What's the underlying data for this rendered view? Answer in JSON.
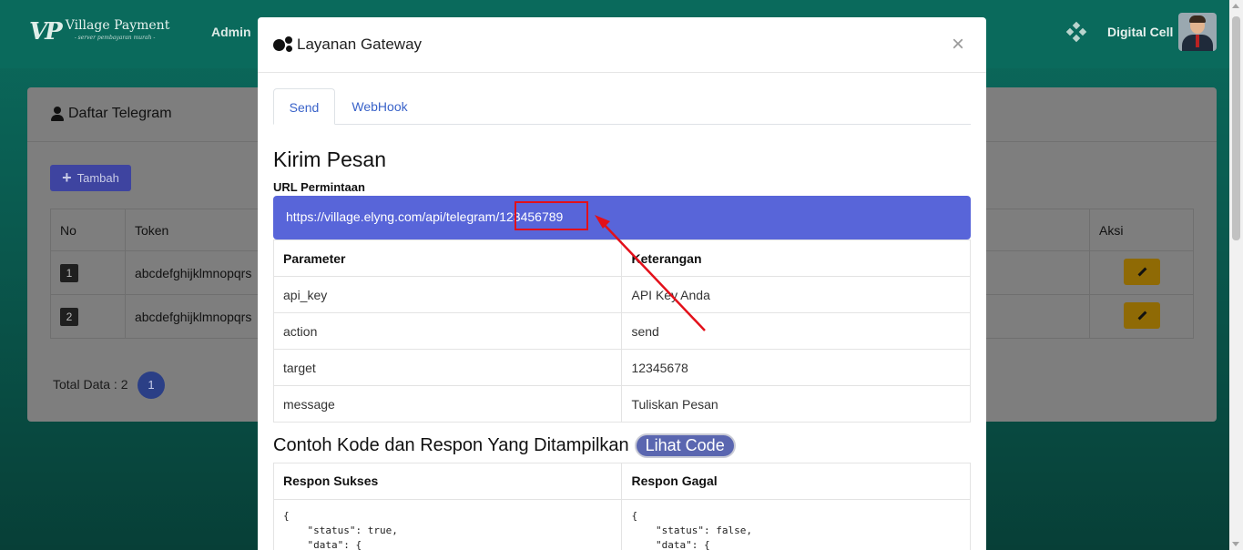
{
  "app": {
    "logo_mark": "VP",
    "logo_name": "Village Payment",
    "logo_tagline": "- server pembayaran murah -",
    "nav_admin": "Admin",
    "user_name": "Digital Cell"
  },
  "card": {
    "title": "Daftar Telegram",
    "add_button": "Tambah",
    "columns": [
      "No",
      "Token",
      "Aksi"
    ],
    "rows": [
      {
        "no": "1",
        "token": "abcdefghijklmnopqrs"
      },
      {
        "no": "2",
        "token": "abcdefghijklmnopqrs"
      }
    ],
    "total_label": "Total Data : 2",
    "current_page": "1"
  },
  "modal": {
    "title": "Layanan Gateway",
    "close": "×",
    "tabs": [
      "Send",
      "WebHook"
    ],
    "active_tab": "Send",
    "heading": "Kirim Pesan",
    "url_label": "URL Permintaan",
    "url": "https://village.elyng.com/api/telegram/123456789",
    "params_header": {
      "param": "Parameter",
      "desc": "Keterangan"
    },
    "params": [
      {
        "param": "api_key",
        "desc": "API Key Anda"
      },
      {
        "param": "action",
        "desc": "send"
      },
      {
        "param": "target",
        "desc": "12345678"
      },
      {
        "param": "message",
        "desc": "Tuliskan Pesan"
      }
    ],
    "example_heading": "Contoh Kode dan Respon Yang Ditampilkan",
    "view_code_button": "Lihat Code",
    "response_success_label": "Respon Sukses",
    "response_fail_label": "Respon Gagal",
    "response_success_code": "{\n    \"status\": true,\n    \"data\": {",
    "response_fail_code": "{\n    \"status\": false,\n    \"data\": {"
  },
  "colors": {
    "accent": "#5865d9",
    "annotation": "#e3101a",
    "tab_link": "#3a63c9"
  }
}
